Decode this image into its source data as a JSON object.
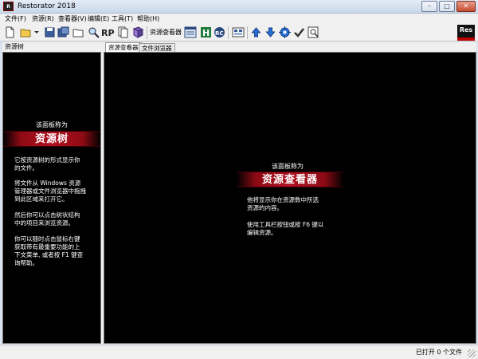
{
  "window": {
    "title": "Restorator 2018",
    "icon_label": "R",
    "controls": {
      "minimize": "–",
      "maximize": "□",
      "close": "✕"
    }
  },
  "menu": {
    "items": [
      {
        "label": "文件(F)"
      },
      {
        "label": "资源(R)"
      },
      {
        "label": "查看器(V)"
      },
      {
        "label": "编辑(E)"
      },
      {
        "label": "工具(T)"
      },
      {
        "label": "帮助(H)"
      }
    ]
  },
  "toolbar": {
    "viewer_label": "资源查看器",
    "logo_text": "Res",
    "icons": [
      "new-file-icon",
      "open-folder-icon",
      "dropdown-arrow-icon",
      "save-icon",
      "save-as-icon",
      "open-folder-2-icon",
      "find-icon",
      "rp-icon",
      "pages-icon",
      "book-icon",
      "viewer-window-icon",
      "hex-icon",
      "rc-icon",
      "file-browser-icon",
      "arrow-up-icon",
      "arrow-down-icon",
      "target-icon",
      "checkmark-icon",
      "preview-icon"
    ]
  },
  "left_panel": {
    "header": "资源树",
    "intro": "该面板称为",
    "title": "资源树",
    "paragraphs": [
      [
        "它按资源树的形式显示你",
        "的文件。"
      ],
      [
        "将文件从 Windows 资源",
        "管理器或文件浏览器中拖拽",
        "到此区域来打开它。"
      ],
      [
        "然后你可以点击树状结构",
        "中的项目来浏览资源。"
      ],
      [
        "你可以随时点击鼠标右键",
        "获取带有最重要功能的上",
        "下文菜单, 或者按 F1 键查",
        "询帮助。"
      ]
    ]
  },
  "right_panel": {
    "tabs": [
      {
        "label": "资源查看器"
      },
      {
        "label": "文件浏览器"
      }
    ],
    "intro": "该面板称为",
    "title": "资源查看器",
    "paragraphs": [
      [
        "他将显示你在资源数中所选",
        "资源的内容。"
      ],
      [
        "使用工具栏按钮或按 F6 键以",
        "编辑资源。"
      ]
    ]
  },
  "status": {
    "text": "已打开 0 个文件"
  },
  "colors": {
    "panel_bg": "#000000",
    "banner_red": "#b01020",
    "chrome": "#f0f0f0"
  }
}
